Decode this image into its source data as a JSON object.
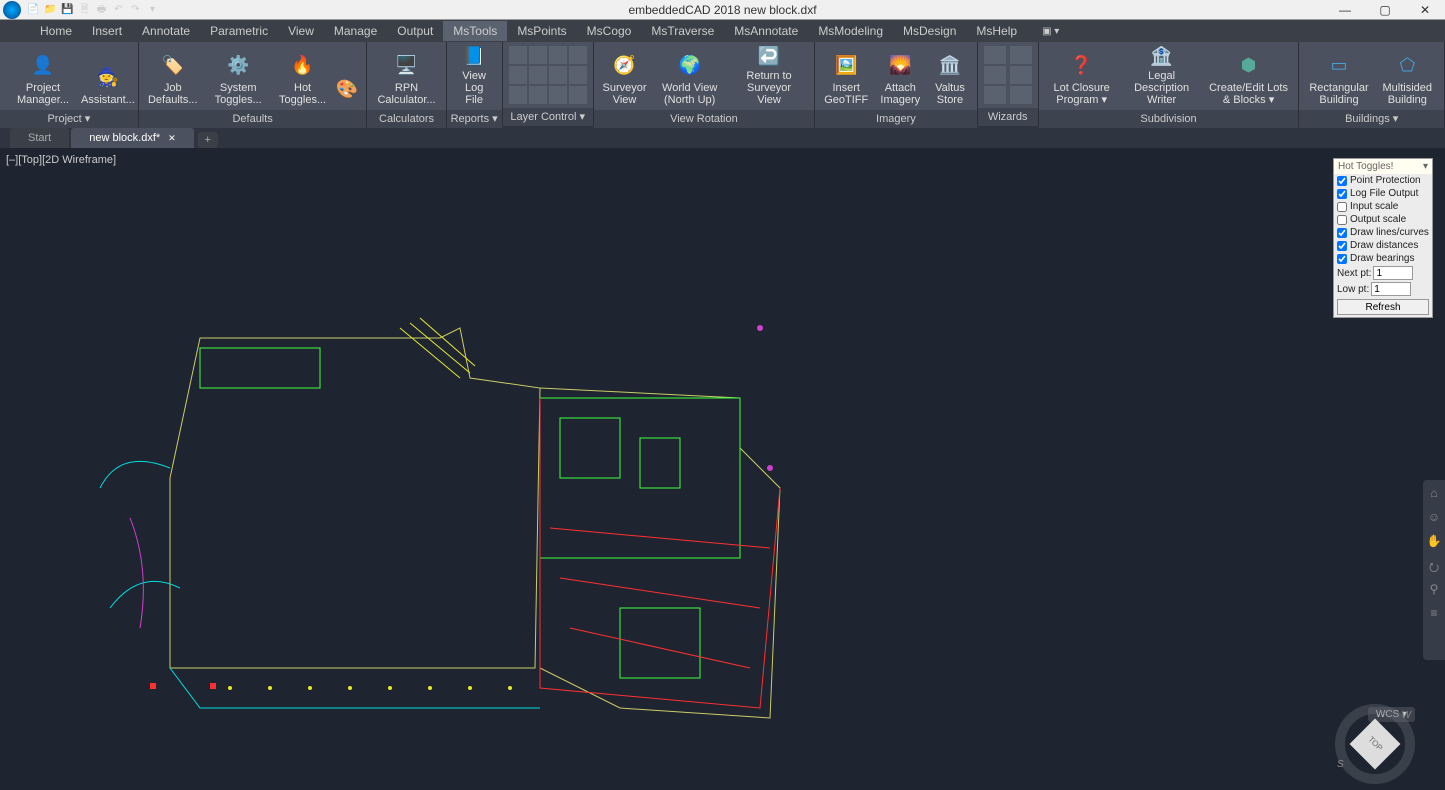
{
  "title": "embeddedCAD 2018   new block.dxf",
  "qat": [
    "📄",
    "📁",
    "💾",
    "🗎",
    "🖶",
    "↶",
    "↷",
    "▾"
  ],
  "menus": [
    "Home",
    "Insert",
    "Annotate",
    "Parametric",
    "View",
    "Manage",
    "Output",
    "MsTools",
    "MsPoints",
    "MsCogo",
    "MsTraverse",
    "MsAnnotate",
    "MsModeling",
    "MsDesign",
    "MsHelp"
  ],
  "active_menu": "MsTools",
  "ribbon": {
    "project": {
      "title": "Project ▾",
      "items": [
        {
          "l": "Project Manager..."
        },
        {
          "l": "Assistant..."
        }
      ]
    },
    "defaults": {
      "title": "Defaults",
      "items": [
        {
          "l": "Job Defaults..."
        },
        {
          "l": "System Toggles..."
        },
        {
          "l": "Hot Toggles..."
        }
      ]
    },
    "calculators": {
      "title": "Calculators",
      "items": [
        {
          "l": "RPN Calculator..."
        }
      ]
    },
    "reports": {
      "title": "Reports ▾",
      "items": [
        {
          "l": "View Log File"
        }
      ]
    },
    "layer": {
      "title": "Layer Control ▾"
    },
    "view_rotation": {
      "title": "View Rotation",
      "items": [
        {
          "l": "Surveyor View"
        },
        {
          "l": "World View (North Up)"
        },
        {
          "l": "Return to Surveyor View"
        }
      ]
    },
    "imagery": {
      "title": "Imagery",
      "items": [
        {
          "l": "Insert GeoTIFF"
        },
        {
          "l": "Attach Imagery"
        },
        {
          "l": "Valtus Store"
        }
      ]
    },
    "wizards": {
      "title": "Wizards"
    },
    "subdivision": {
      "title": "Subdivision",
      "items": [
        {
          "l": "Lot Closure Program ▾"
        },
        {
          "l": "Legal Description Writer"
        },
        {
          "l": "Create/Edit Lots & Blocks ▾"
        }
      ]
    },
    "buildings": {
      "title": "Buildings ▾",
      "items": [
        {
          "l": "Rectangular Building"
        },
        {
          "l": "Multisided Building"
        }
      ]
    }
  },
  "tabs": {
    "start": "Start",
    "active": "new block.dxf*"
  },
  "view_label": "[–][Top][2D Wireframe]",
  "hot": {
    "title": "Hot Toggles!",
    "items": [
      {
        "l": "Point Protection",
        "c": true
      },
      {
        "l": "Log File Output",
        "c": true
      },
      {
        "l": "Input scale",
        "c": false
      },
      {
        "l": "Output scale",
        "c": false
      },
      {
        "l": "Draw lines/curves",
        "c": true
      },
      {
        "l": "Draw distances",
        "c": true
      },
      {
        "l": "Draw bearings",
        "c": true
      }
    ],
    "next_pt_label": "Next pt:",
    "next_pt": "1",
    "low_pt_label": "Low pt:",
    "low_pt": "1",
    "refresh": "Refresh"
  },
  "wcs": "WCS ▾",
  "cube": {
    "top": "TOP",
    "w": "W",
    "s": "S"
  }
}
